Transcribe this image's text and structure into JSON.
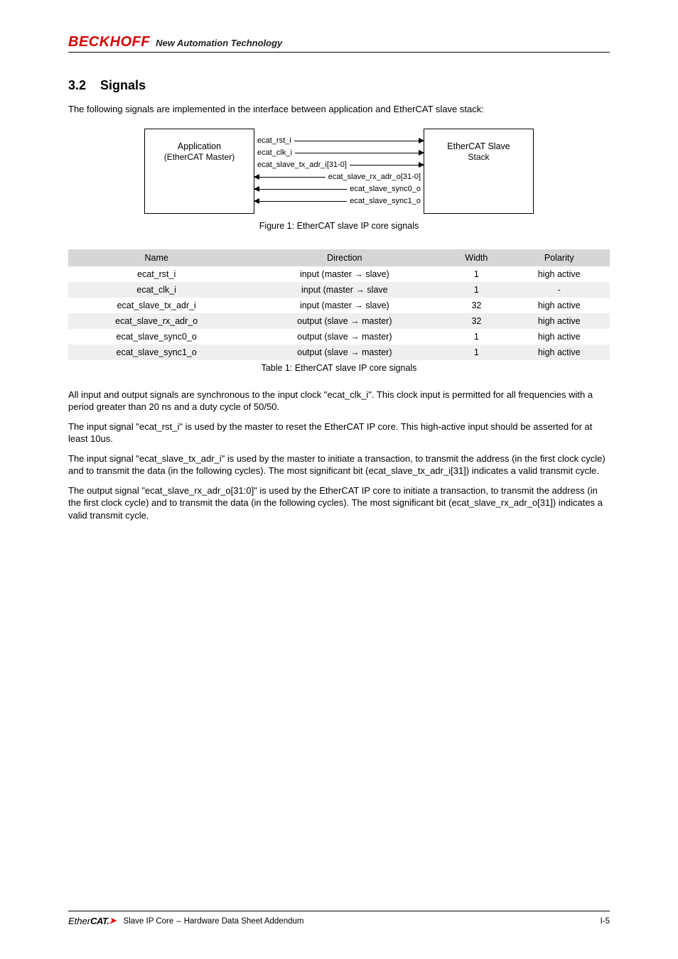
{
  "header": {
    "brand": "BECKHOFF",
    "tagline": "New Automation Technology"
  },
  "section": {
    "number": "3.2",
    "title": "Signals"
  },
  "intro": "The following signals are implemented in the interface between application and EtherCAT slave stack:",
  "diagram": {
    "left_box": {
      "line1": "Application",
      "line2": "(EtherCAT Master)"
    },
    "right_box": {
      "line1": "EtherCAT Slave",
      "line2": "Stack"
    },
    "arrows": [
      {
        "dir": "right",
        "label": "ecat_rst_i"
      },
      {
        "dir": "right",
        "label": "ecat_clk_i"
      },
      {
        "dir": "right",
        "label": "ecat_slave_tx_adr_i[31-0]"
      },
      {
        "dir": "left",
        "label": "ecat_slave_rx_adr_o[31-0]"
      },
      {
        "dir": "left",
        "label": "ecat_slave_sync0_o"
      },
      {
        "dir": "left",
        "label": "ecat_slave_sync1_o"
      }
    ],
    "caption_label": "Figure 1:",
    "caption_text": "EtherCAT slave IP core signals"
  },
  "table": {
    "headers": [
      "Name",
      "Direction",
      "Width",
      "Polarity"
    ],
    "rows": [
      {
        "name": "ecat_rst_i",
        "dir_pre": "input ",
        "dir_arrow": "(master → slave)",
        "width": "1",
        "polarity": "high active"
      },
      {
        "name": "ecat_clk_i",
        "dir_pre": "input ",
        "dir_arrow": "(master → slave",
        "width": "1",
        "polarity": "-"
      },
      {
        "name": "ecat_slave_tx_adr_i",
        "dir_pre": "input ",
        "dir_arrow": "(master → slave)",
        "width": "32",
        "polarity": "high active"
      },
      {
        "name": "ecat_slave_rx_adr_o",
        "dir_pre": "output ",
        "dir_arrow": "(slave → master)",
        "width": "32",
        "polarity": "high active"
      },
      {
        "name": "ecat_slave_sync0_o",
        "dir_pre": "output ",
        "dir_arrow": "(slave → master)",
        "width": "1",
        "polarity": "high active"
      },
      {
        "name": "ecat_slave_sync1_o",
        "dir_pre": "output ",
        "dir_arrow": "(slave → master)",
        "width": "1",
        "polarity": "high active"
      }
    ],
    "caption_label": "Table 1:",
    "caption_text": "EtherCAT slave IP core signals"
  },
  "paragraphs": {
    "p1": "All input and output signals are synchronous to the input clock \"ecat_clk_i\". This clock input is permitted for all frequencies with a period greater than 20 ns and a duty cycle of 50/50.",
    "p2": "The input signal \"ecat_rst_i\" is used by the master to reset the EtherCAT IP core. This high-active input should be asserted for at least 10us.",
    "p3_a": "The input signal \"ecat_slave_tx_adr_i\" is used by the master to initiate a transaction, to transmit the address (in the first clock cycle) and to transmit the data (in the following cycles). The most significant bit (",
    "p3_b": ") indicates a valid transmit cycle.",
    "p4_a": "The output signal \"ecat_slave_rx_adr_o[31:0]\" is used by the EtherCAT IP core to initiate a transaction, to transmit the address (in the first clock cycle) and to transmit the data (in the following cycles). The most significant bit (",
    "p4_b": ") indicates a valid transmit cycle."
  },
  "code": {
    "tx_bit": "ecat_slave_tx_adr_i[31]",
    "rx_bit": "ecat_slave_rx_adr_o[31]"
  },
  "footer": {
    "logo_ether": "Ether",
    "logo_cat": "CAT.",
    "text_a": "Slave IP Core ",
    "dash": "–",
    "text_b": " Hardware Data Sheet Addendum",
    "page": "I-5"
  }
}
